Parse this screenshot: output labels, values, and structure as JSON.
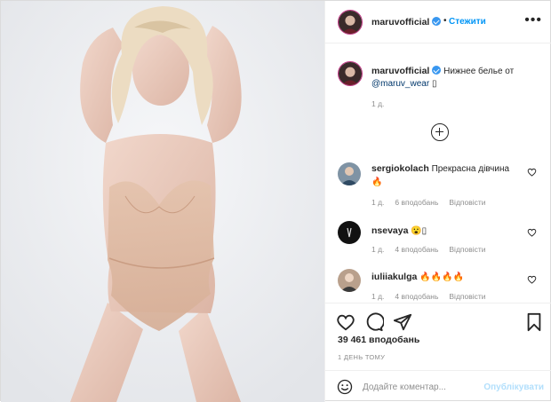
{
  "post": {
    "photo_icon": "portrait-photo",
    "author": {
      "username": "maruvofficial",
      "verified": true,
      "separator": "•",
      "follow_label": "Стежити",
      "more_icon": "more-horizontal-icon",
      "more_label": "•••"
    },
    "caption": {
      "username": "maruvofficial",
      "text": "Нижнее белье от",
      "mention": "@maruv_wear",
      "trailing_glyph": "▯",
      "time": "1 д."
    },
    "load_more_icon": "plus-circle-icon",
    "comments": [
      {
        "username": "sergiokolach",
        "text": "Прекрасна дівчина",
        "emoji": "🔥",
        "time": "1 д.",
        "likes": "6 вподобань",
        "reply": "Відповісти"
      },
      {
        "username": "nsevaya",
        "text": "😮▯",
        "time": "1 д.",
        "likes": "4 вподобань",
        "reply": "Відповісти"
      },
      {
        "username": "iuliiakulga",
        "text": "🔥🔥🔥🔥",
        "time": "1 д.",
        "likes": "4 вподобань",
        "reply": "Відповісти"
      }
    ],
    "likes_count": "39 461 вподобань",
    "posted": "1 ДЕНЬ ТОМУ",
    "add_comment": {
      "placeholder": "Додайте коментар...",
      "publish_label": "Опублікувати"
    },
    "colors": {
      "accent": "#0095f6",
      "verified": "#3897f0",
      "muted": "#8e8e8e",
      "publish_disabled": "#b2dffc"
    }
  }
}
